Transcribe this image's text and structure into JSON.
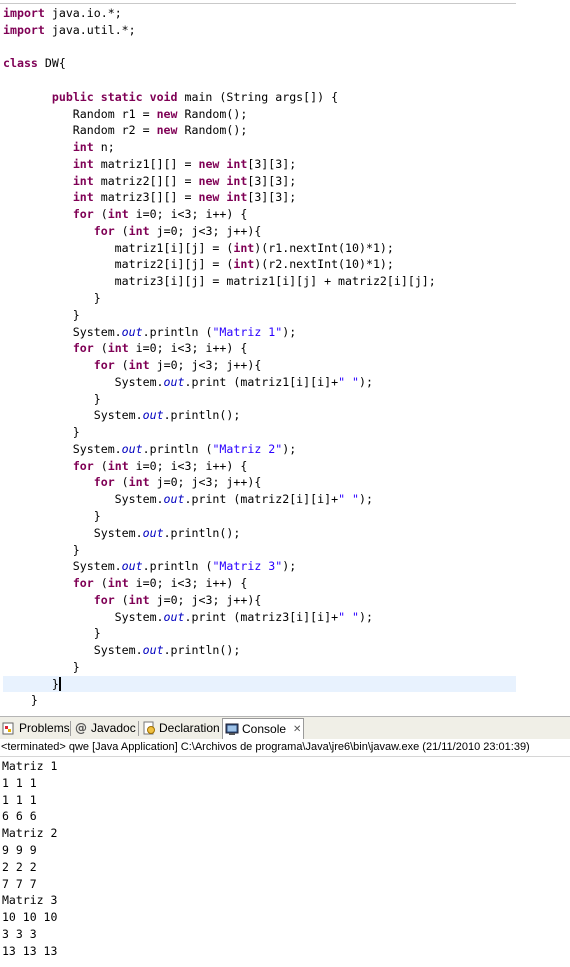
{
  "editor": {
    "lines": [
      [
        {
          "t": "import",
          "c": "kw"
        },
        {
          "t": " java.io.*;",
          "c": "plain"
        }
      ],
      [
        {
          "t": "import",
          "c": "kw"
        },
        {
          "t": " java.util.*;",
          "c": "plain"
        }
      ],
      [],
      [
        {
          "t": "class",
          "c": "kw"
        },
        {
          "t": " DW{",
          "c": "plain"
        }
      ],
      [],
      [
        {
          "t": "       ",
          "c": "plain"
        },
        {
          "t": "public static void",
          "c": "kw"
        },
        {
          "t": " main (String args[]) {",
          "c": "plain"
        }
      ],
      [
        {
          "t": "          Random r1 = ",
          "c": "plain"
        },
        {
          "t": "new",
          "c": "kw"
        },
        {
          "t": " Random();",
          "c": "plain"
        }
      ],
      [
        {
          "t": "          Random r2 = ",
          "c": "plain"
        },
        {
          "t": "new",
          "c": "kw"
        },
        {
          "t": " Random();",
          "c": "plain"
        }
      ],
      [
        {
          "t": "          ",
          "c": "plain"
        },
        {
          "t": "int",
          "c": "kw"
        },
        {
          "t": " n;",
          "c": "plain"
        }
      ],
      [
        {
          "t": "          ",
          "c": "plain"
        },
        {
          "t": "int",
          "c": "kw"
        },
        {
          "t": " matriz1[][] = ",
          "c": "plain"
        },
        {
          "t": "new int",
          "c": "kw"
        },
        {
          "t": "[3][3];",
          "c": "plain"
        }
      ],
      [
        {
          "t": "          ",
          "c": "plain"
        },
        {
          "t": "int",
          "c": "kw"
        },
        {
          "t": " matriz2[][] = ",
          "c": "plain"
        },
        {
          "t": "new int",
          "c": "kw"
        },
        {
          "t": "[3][3];",
          "c": "plain"
        }
      ],
      [
        {
          "t": "          ",
          "c": "plain"
        },
        {
          "t": "int",
          "c": "kw"
        },
        {
          "t": " matriz3[][] = ",
          "c": "plain"
        },
        {
          "t": "new int",
          "c": "kw"
        },
        {
          "t": "[3][3];",
          "c": "plain"
        }
      ],
      [
        {
          "t": "          ",
          "c": "plain"
        },
        {
          "t": "for",
          "c": "kw"
        },
        {
          "t": " (",
          "c": "plain"
        },
        {
          "t": "int",
          "c": "kw"
        },
        {
          "t": " i=0; i<3; i++) {",
          "c": "plain"
        }
      ],
      [
        {
          "t": "             ",
          "c": "plain"
        },
        {
          "t": "for",
          "c": "kw"
        },
        {
          "t": " (",
          "c": "plain"
        },
        {
          "t": "int",
          "c": "kw"
        },
        {
          "t": " j=0; j<3; j++){",
          "c": "plain"
        }
      ],
      [
        {
          "t": "                matriz1[i][j] = (",
          "c": "plain"
        },
        {
          "t": "int",
          "c": "kw"
        },
        {
          "t": ")(r1.nextInt(10)*1);",
          "c": "plain"
        }
      ],
      [
        {
          "t": "                matriz2[i][j] = (",
          "c": "plain"
        },
        {
          "t": "int",
          "c": "kw"
        },
        {
          "t": ")(r2.nextInt(10)*1);",
          "c": "plain"
        }
      ],
      [
        {
          "t": "                matriz3[i][j] = matriz1[i][j] + matriz2[i][j];",
          "c": "plain"
        }
      ],
      [
        {
          "t": "             }",
          "c": "plain"
        }
      ],
      [
        {
          "t": "          }",
          "c": "plain"
        }
      ],
      [
        {
          "t": "          System.",
          "c": "plain"
        },
        {
          "t": "out",
          "c": "fld"
        },
        {
          "t": ".println (",
          "c": "plain"
        },
        {
          "t": "\"Matriz 1\"",
          "c": "str"
        },
        {
          "t": ");",
          "c": "plain"
        }
      ],
      [
        {
          "t": "          ",
          "c": "plain"
        },
        {
          "t": "for",
          "c": "kw"
        },
        {
          "t": " (",
          "c": "plain"
        },
        {
          "t": "int",
          "c": "kw"
        },
        {
          "t": " i=0; i<3; i++) {",
          "c": "plain"
        }
      ],
      [
        {
          "t": "             ",
          "c": "plain"
        },
        {
          "t": "for",
          "c": "kw"
        },
        {
          "t": " (",
          "c": "plain"
        },
        {
          "t": "int",
          "c": "kw"
        },
        {
          "t": " j=0; j<3; j++){",
          "c": "plain"
        }
      ],
      [
        {
          "t": "                System.",
          "c": "plain"
        },
        {
          "t": "out",
          "c": "fld"
        },
        {
          "t": ".print (matriz1[i][i]+",
          "c": "plain"
        },
        {
          "t": "\" \"",
          "c": "str"
        },
        {
          "t": ");",
          "c": "plain"
        }
      ],
      [
        {
          "t": "             }",
          "c": "plain"
        }
      ],
      [
        {
          "t": "             System.",
          "c": "plain"
        },
        {
          "t": "out",
          "c": "fld"
        },
        {
          "t": ".println();",
          "c": "plain"
        }
      ],
      [
        {
          "t": "          }",
          "c": "plain"
        }
      ],
      [
        {
          "t": "          System.",
          "c": "plain"
        },
        {
          "t": "out",
          "c": "fld"
        },
        {
          "t": ".println (",
          "c": "plain"
        },
        {
          "t": "\"Matriz 2\"",
          "c": "str"
        },
        {
          "t": ");",
          "c": "plain"
        }
      ],
      [
        {
          "t": "          ",
          "c": "plain"
        },
        {
          "t": "for",
          "c": "kw"
        },
        {
          "t": " (",
          "c": "plain"
        },
        {
          "t": "int",
          "c": "kw"
        },
        {
          "t": " i=0; i<3; i++) {",
          "c": "plain"
        }
      ],
      [
        {
          "t": "             ",
          "c": "plain"
        },
        {
          "t": "for",
          "c": "kw"
        },
        {
          "t": " (",
          "c": "plain"
        },
        {
          "t": "int",
          "c": "kw"
        },
        {
          "t": " j=0; j<3; j++){",
          "c": "plain"
        }
      ],
      [
        {
          "t": "                System.",
          "c": "plain"
        },
        {
          "t": "out",
          "c": "fld"
        },
        {
          "t": ".print (matriz2[i][i]+",
          "c": "plain"
        },
        {
          "t": "\" \"",
          "c": "str"
        },
        {
          "t": ");",
          "c": "plain"
        }
      ],
      [
        {
          "t": "             }",
          "c": "plain"
        }
      ],
      [
        {
          "t": "             System.",
          "c": "plain"
        },
        {
          "t": "out",
          "c": "fld"
        },
        {
          "t": ".println();",
          "c": "plain"
        }
      ],
      [
        {
          "t": "          }",
          "c": "plain"
        }
      ],
      [
        {
          "t": "          System.",
          "c": "plain"
        },
        {
          "t": "out",
          "c": "fld"
        },
        {
          "t": ".println (",
          "c": "plain"
        },
        {
          "t": "\"Matriz 3\"",
          "c": "str"
        },
        {
          "t": ");",
          "c": "plain"
        }
      ],
      [
        {
          "t": "          ",
          "c": "plain"
        },
        {
          "t": "for",
          "c": "kw"
        },
        {
          "t": " (",
          "c": "plain"
        },
        {
          "t": "int",
          "c": "kw"
        },
        {
          "t": " i=0; i<3; i++) {",
          "c": "plain"
        }
      ],
      [
        {
          "t": "             ",
          "c": "plain"
        },
        {
          "t": "for",
          "c": "kw"
        },
        {
          "t": " (",
          "c": "plain"
        },
        {
          "t": "int",
          "c": "kw"
        },
        {
          "t": " j=0; j<3; j++){",
          "c": "plain"
        }
      ],
      [
        {
          "t": "                System.",
          "c": "plain"
        },
        {
          "t": "out",
          "c": "fld"
        },
        {
          "t": ".print (matriz3[i][i]+",
          "c": "plain"
        },
        {
          "t": "\" \"",
          "c": "str"
        },
        {
          "t": ");",
          "c": "plain"
        }
      ],
      [
        {
          "t": "             }",
          "c": "plain"
        }
      ],
      [
        {
          "t": "             System.",
          "c": "plain"
        },
        {
          "t": "out",
          "c": "fld"
        },
        {
          "t": ".println();",
          "c": "plain"
        }
      ],
      [
        {
          "t": "          }",
          "c": "plain"
        }
      ],
      [
        {
          "t": "       }",
          "c": "plain"
        }
      ],
      [
        {
          "t": "    }",
          "c": "plain"
        }
      ]
    ],
    "current_line": 40
  },
  "views": {
    "tabs": [
      {
        "label": "Problems",
        "icon": "problems-icon"
      },
      {
        "label": "Javadoc",
        "icon": "at-sign-icon"
      },
      {
        "label": "Declaration",
        "icon": "declaration-icon"
      },
      {
        "label": "Console",
        "icon": "console-icon",
        "active": true
      }
    ],
    "close_glyph": "✕"
  },
  "console": {
    "status": "<terminated> qwe [Java Application] C:\\Archivos de programa\\Java\\jre6\\bin\\javaw.exe (21/11/2010 23:01:39)",
    "output": [
      "Matriz 1",
      "1 1 1",
      "1 1 1",
      "6 6 6",
      "Matriz 2",
      "9 9 9",
      "2 2 2",
      "7 7 7",
      "Matriz 3",
      "10 10 10",
      "3 3 3",
      "13 13 13"
    ]
  },
  "colors": {
    "keyword": "#7f0055",
    "string": "#2a00ff",
    "field": "#0000c0",
    "current_line": "#e8f2fe"
  }
}
